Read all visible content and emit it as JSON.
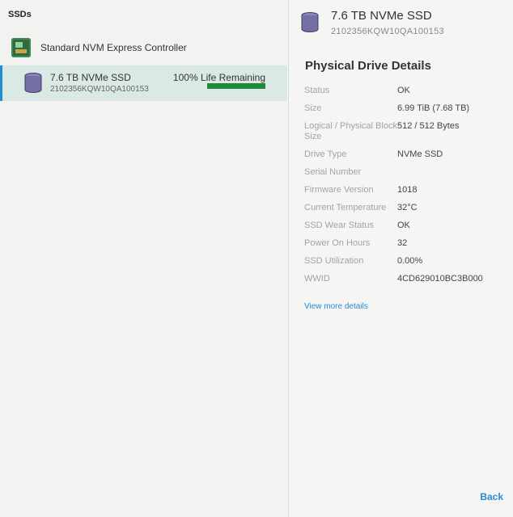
{
  "left_pane": {
    "title": "SSDs",
    "controller": {
      "label": "Standard NVM Express Controller",
      "icon": "controller-card-icon"
    },
    "drive": {
      "name": "7.6 TB NVMe SSD",
      "serial": "2102356KQW10QA100153",
      "life_text": "100% Life Remaining",
      "life_fraction": 1.0,
      "icon": "disk-stack-icon"
    }
  },
  "right_pane": {
    "header": {
      "title": "7.6 TB NVMe SSD",
      "serial": "2102356KQW10QA100153",
      "icon": "disk-stack-icon"
    },
    "section_title": "Physical Drive Details",
    "details": [
      {
        "label": "Status",
        "value": "OK"
      },
      {
        "label": "Size",
        "value": "6.99 TiB (7.68 TB)"
      },
      {
        "label": "Logical / Physical Block Size",
        "value": "512 / 512 Bytes"
      },
      {
        "label": "Drive Type",
        "value": "NVMe SSD"
      },
      {
        "label": "Serial Number",
        "value": ""
      },
      {
        "label": "Firmware Version",
        "value": "1018"
      },
      {
        "label": "Current Temperature",
        "value": "32°C"
      },
      {
        "label": "SSD Wear Status",
        "value": "OK"
      },
      {
        "label": "Power On Hours",
        "value": "32"
      },
      {
        "label": "SSD Utilization",
        "value": "0.00%"
      },
      {
        "label": "WWID",
        "value": "4CD629010BC3B000"
      }
    ],
    "view_more_label": "View more details",
    "back_label": "Back"
  },
  "colors": {
    "accent": "#2a8bd4",
    "selection": "#dbe9e4",
    "life_bar": "#1e8a3a"
  }
}
